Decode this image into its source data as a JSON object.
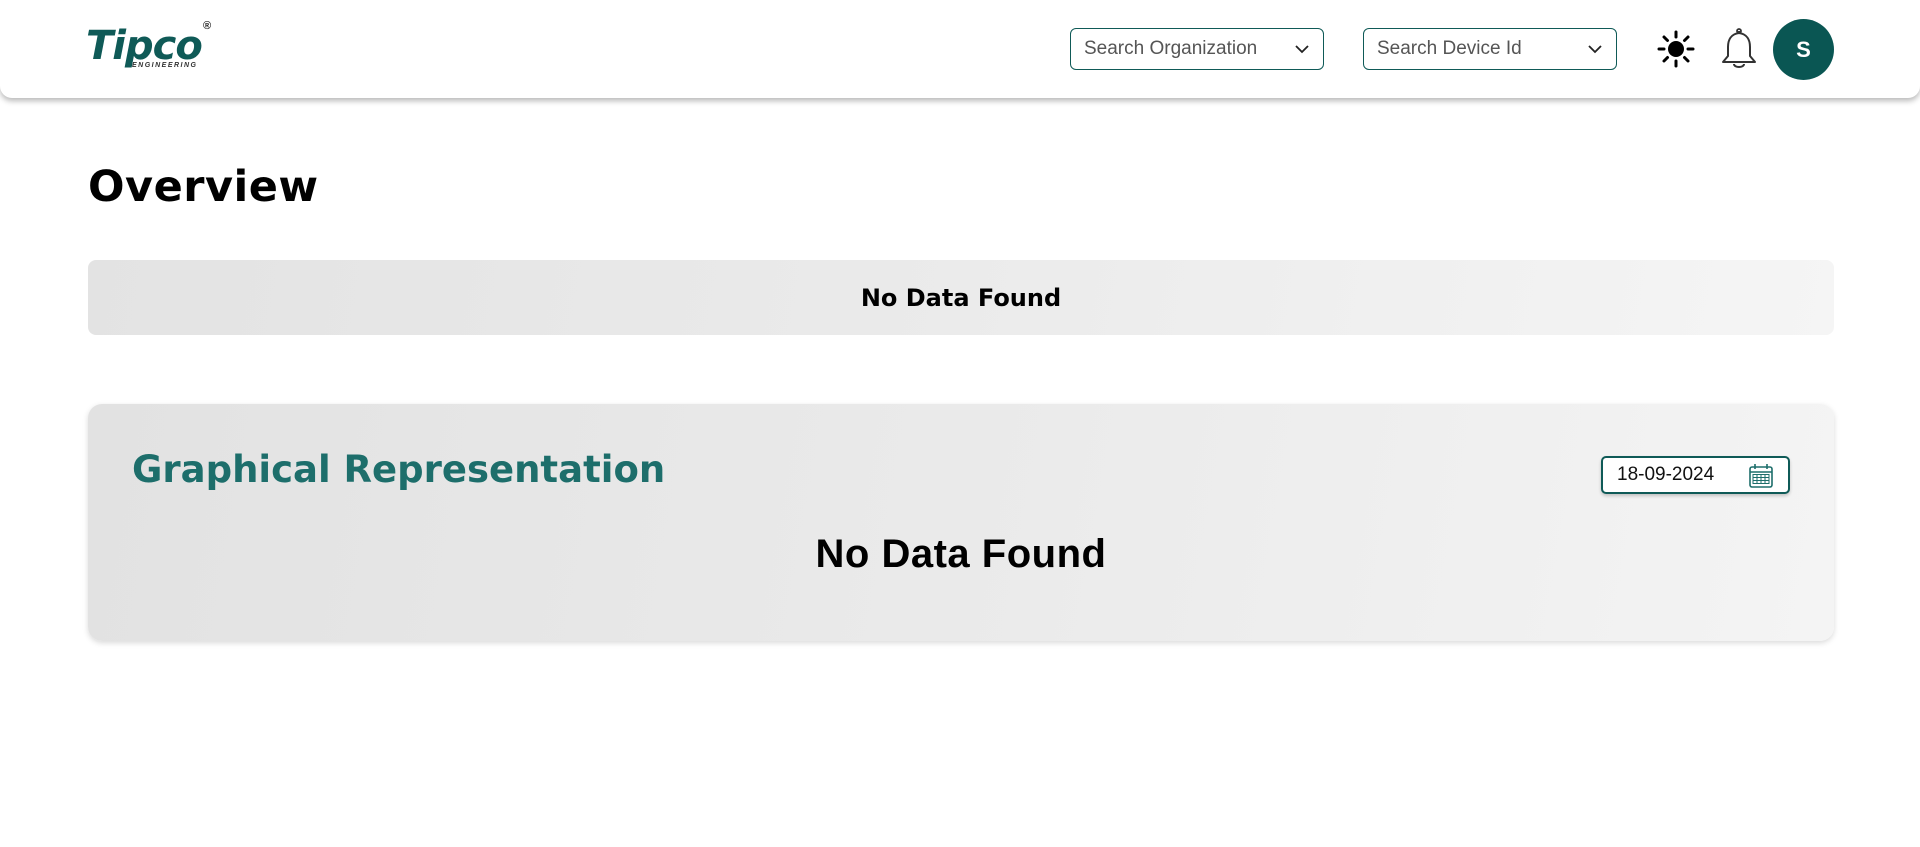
{
  "header": {
    "logo": {
      "text": "Tipco",
      "registered": "®",
      "subtitle": "ENGINEERING",
      "brand_color": "#0f5a57"
    },
    "org_select": {
      "placeholder": "Search Organization"
    },
    "device_select": {
      "placeholder": "Search Device Id"
    },
    "theme_icon": "sun-icon",
    "notification_icon": "bell-icon",
    "avatar": {
      "initial": "S",
      "color": "#0a5653"
    }
  },
  "main": {
    "title": "Overview",
    "summary": {
      "empty_message": "No Data Found"
    },
    "graph": {
      "title": "Graphical Representation",
      "title_color": "#1d6e6b",
      "date": "18-09-2024",
      "date_icon": "calendar-icon",
      "empty_message": "No Data Found"
    }
  }
}
